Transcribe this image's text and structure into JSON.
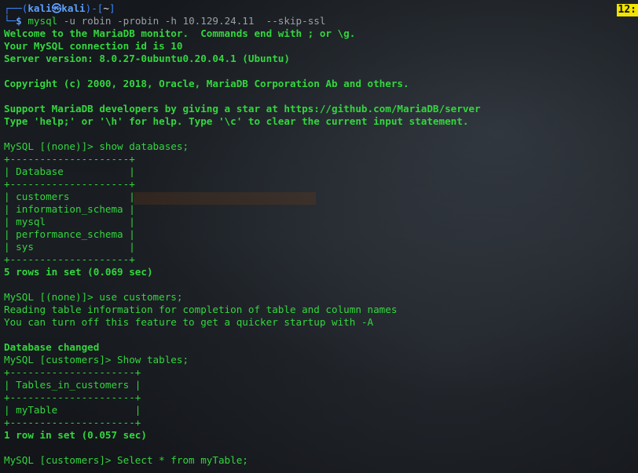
{
  "prompt": {
    "frame_left": "┌──(",
    "user": "kali",
    "at": "㉿",
    "host": "kali",
    "dir_open": ")-[",
    "dir": "~",
    "dir_close": "]",
    "frame_bottom": "└─",
    "dollar": "$ ",
    "cmd": "mysql",
    "args": " -u robin -probin -h 10.129.24.11  --skip-ssl"
  },
  "clock": "12:",
  "output": [
    {
      "text": "Welcome to the MariaDB monitor.  Commands end with ; or \\g.",
      "style": "gb"
    },
    {
      "text": "Your MySQL connection id is 10",
      "style": "gb"
    },
    {
      "text": "Server version: 8.0.27-0ubuntu0.20.04.1 (Ubuntu)",
      "style": "gb"
    },
    {
      "text": "",
      "style": "g"
    },
    {
      "text": "Copyright (c) 2000, 2018, Oracle, MariaDB Corporation Ab and others.",
      "style": "gb"
    },
    {
      "text": "",
      "style": "g"
    },
    {
      "text": "Support MariaDB developers by giving a star at https://github.com/MariaDB/server",
      "style": "gb"
    },
    {
      "text": "Type 'help;' or '\\h' for help. Type '\\c' to clear the current input statement.",
      "style": "gb"
    },
    {
      "text": "",
      "style": "g"
    },
    {
      "text": "MySQL [(none)]> show databases;",
      "style": "g"
    },
    {
      "text": "+--------------------+",
      "style": "g"
    },
    {
      "text": "| Database           |",
      "style": "g"
    },
    {
      "text": "+--------------------+",
      "style": "g"
    },
    {
      "text": "| customers          |",
      "style": "g"
    },
    {
      "text": "| information_schema |",
      "style": "g"
    },
    {
      "text": "| mysql              |",
      "style": "g"
    },
    {
      "text": "| performance_schema |",
      "style": "g"
    },
    {
      "text": "| sys                |",
      "style": "g"
    },
    {
      "text": "+--------------------+",
      "style": "g"
    },
    {
      "text": "5 rows in set (0.069 sec)",
      "style": "gb"
    },
    {
      "text": "",
      "style": "g"
    },
    {
      "text": "MySQL [(none)]> use customers;",
      "style": "g"
    },
    {
      "text": "Reading table information for completion of table and column names",
      "style": "g"
    },
    {
      "text": "You can turn off this feature to get a quicker startup with -A",
      "style": "g"
    },
    {
      "text": "",
      "style": "g"
    },
    {
      "text": "Database changed",
      "style": "gb"
    },
    {
      "text": "MySQL [customers]> Show tables;",
      "style": "g"
    },
    {
      "text": "+---------------------+",
      "style": "g"
    },
    {
      "text": "| Tables_in_customers |",
      "style": "g"
    },
    {
      "text": "+---------------------+",
      "style": "g"
    },
    {
      "text": "| myTable             |",
      "style": "g"
    },
    {
      "text": "+---------------------+",
      "style": "g"
    },
    {
      "text": "1 row in set (0.057 sec)",
      "style": "gb"
    },
    {
      "text": "",
      "style": "g"
    },
    {
      "text": "MySQL [customers]> Select * from myTable;",
      "style": "g"
    }
  ],
  "colors": {
    "green": "#33d63e",
    "blue": "#3a86ff",
    "clock_bg": "#f2e300",
    "background": "#121519"
  }
}
